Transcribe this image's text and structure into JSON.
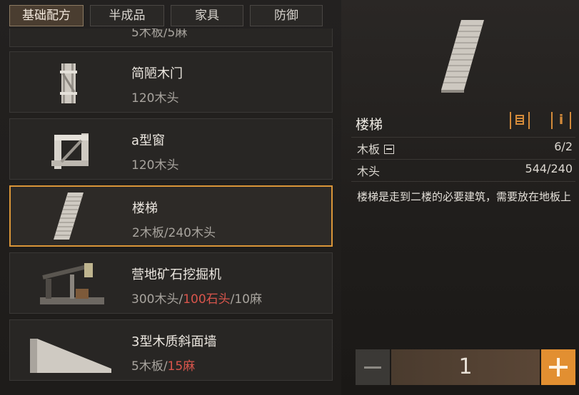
{
  "tabs": [
    {
      "label": "基础配方",
      "active": true
    },
    {
      "label": "半成品",
      "active": false
    },
    {
      "label": "家具",
      "active": false
    },
    {
      "label": "防御",
      "active": false
    }
  ],
  "recipes": [
    {
      "name": "",
      "cost": "5木板/5麻"
    },
    {
      "name": "简陋木门",
      "cost": "120木头"
    },
    {
      "name": "a型窗",
      "cost": "120木头"
    },
    {
      "name": "楼梯",
      "cost": "2木板/240木头",
      "selected": true
    },
    {
      "name": "营地矿石挖掘机",
      "cost_parts": [
        "300木头/",
        "100石头",
        "/10麻"
      ]
    },
    {
      "name": "3型木质斜面墙",
      "cost_parts": [
        "5木板/",
        "15麻"
      ]
    }
  ],
  "detail": {
    "title": "楼梯",
    "craft_icon": "blueprint-icon",
    "info_icon_label": "i",
    "requirements": [
      {
        "name": "木板",
        "value": "6/2"
      },
      {
        "name": "木头",
        "value": "544/240"
      }
    ],
    "description": "楼梯是走到二楼的必要建筑，需要放在地板上"
  },
  "quantity": {
    "value": "1",
    "minus_icon": "minus-icon",
    "plus_icon": "plus-icon"
  },
  "colors": {
    "accent": "#d99538",
    "warning": "#d9554c",
    "panel": "#282624"
  }
}
